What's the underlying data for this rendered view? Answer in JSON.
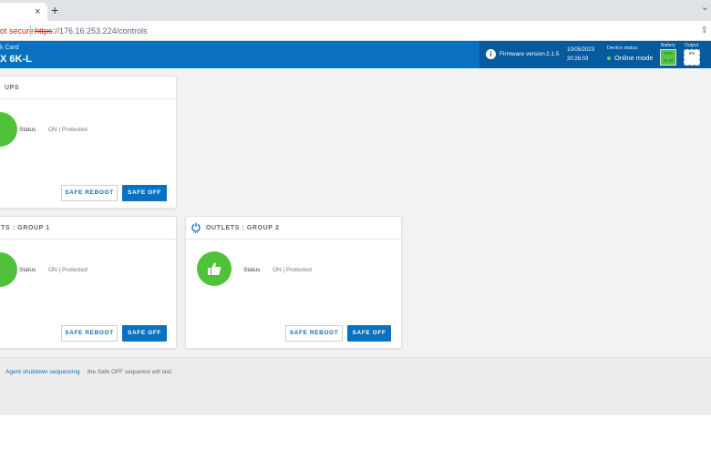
{
  "browser": {
    "tab_close": "×",
    "new_tab": "+",
    "tabs_menu": "⌄",
    "not_secure": "ot secure",
    "url_scheme": "https",
    "url_rest": "://176.16.253.224/controls"
  },
  "header": {
    "brand_sub": "k Card",
    "brand_main": "X 6K-L",
    "firmware_label": "Firmware version",
    "firmware_version": "2.1.5",
    "date": "10/05/2023",
    "time": "20:26:03",
    "device_status_label": "Device status:",
    "device_status_value": "Online mode",
    "battery_label": "Battery",
    "battery_value_top": "93%",
    "battery_value_bottom": "49:25",
    "output_label": "Output",
    "output_value": "0%"
  },
  "cards": {
    "ups": {
      "title": "UPS",
      "status_label": "Status",
      "status_value": "ON | Protected",
      "reboot_label": "SAFE REBOOT",
      "off_label": "SAFE OFF"
    },
    "group1": {
      "title": "TS : GROUP 1",
      "status_label": "Status",
      "status_value": "ON | Protected",
      "reboot_label": "SAFE REBOOT",
      "off_label": "SAFE OFF"
    },
    "group2": {
      "title": "OUTLETS : GROUP 2",
      "status_label": "Status",
      "status_value": "ON | Protected",
      "reboot_label": "SAFE REBOOT",
      "off_label": "SAFE OFF"
    }
  },
  "footer": {
    "agent_link": "Agent shutdown sequencing",
    "agent_text": "the Safe OFF sequence will last:"
  },
  "colors": {
    "brand_blue": "#0a70c0",
    "status_green": "#4fc23a"
  },
  "icons": {
    "info": "info-icon",
    "power": "power-icon",
    "thumbs_up": "thumbs-up-icon"
  }
}
